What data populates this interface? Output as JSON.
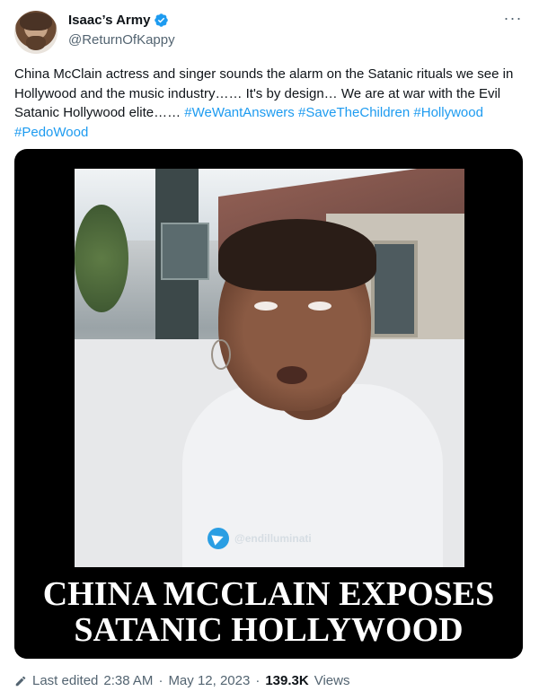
{
  "author": {
    "display_name": "Isaac’s Army",
    "handle": "@ReturnOfKappy",
    "avatar_icon": "avatar",
    "verified_icon": "verified-badge-icon",
    "verified_color": "#1d9bf0"
  },
  "menu": {
    "more_label": "···"
  },
  "tweet": {
    "text_plain": "China McClain actress and singer sounds the alarm on the Satanic rituals we see in Hollywood and the music industry…… It's by design… We are at war with the Evil Satanic Hollywood elite…… ",
    "hashtags": [
      "#WeWantAnswers",
      "#SaveTheChildren",
      "#Hollywood",
      "#PedoWood"
    ],
    "link_color": "#1d9bf0"
  },
  "media": {
    "watermark": "@endilluminati",
    "caption_line1": "CHINA MCCLAIN EXPOSES",
    "caption_line2": "SATANIC HOLLYWOOD"
  },
  "footer": {
    "edit_label": "Last edited",
    "time": "2:38 AM",
    "separator1": "·",
    "date": "May 12, 2023",
    "separator2": "·",
    "views_count": "139.3K",
    "views_label": "Views"
  }
}
